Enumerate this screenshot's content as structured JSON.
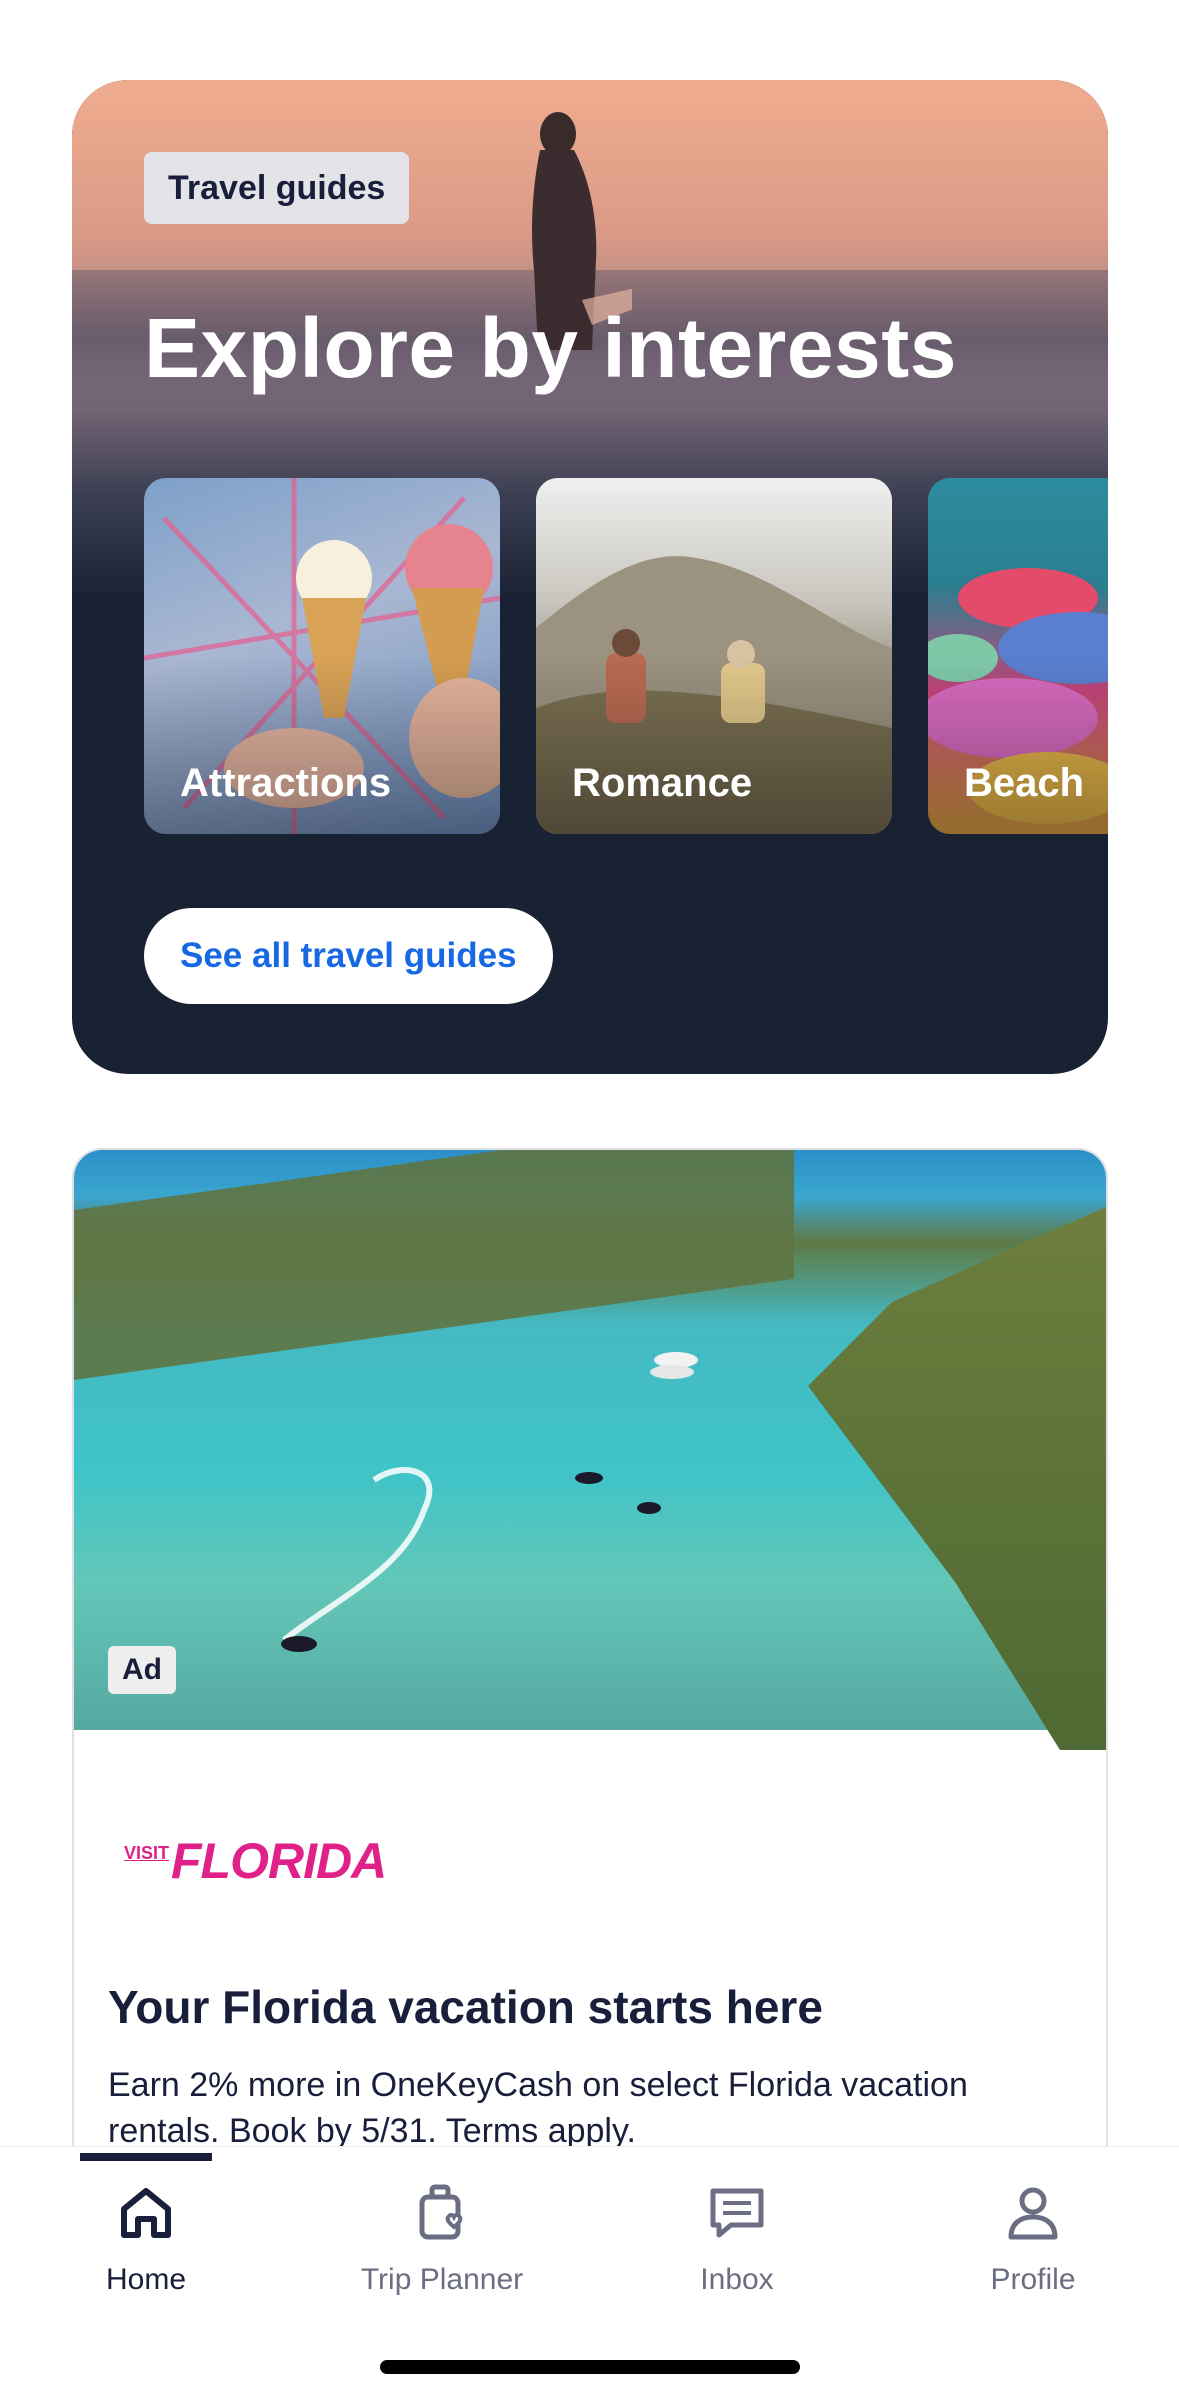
{
  "explore": {
    "tag": "Travel guides",
    "title": "Explore by interests",
    "tiles": [
      {
        "label": "Attractions"
      },
      {
        "label": "Romance"
      },
      {
        "label": "Beach"
      }
    ],
    "see_all": "See all travel guides"
  },
  "ad": {
    "badge": "Ad",
    "brand_small": "VISIT",
    "brand_main": "FLORIDA",
    "headline": "Your Florida vacation starts here",
    "body": "Earn 2% more in OneKeyCash on select Florida vacation rentals. Book by 5/31. Terms apply."
  },
  "nav": {
    "items": [
      {
        "label": "Home",
        "icon": "home-icon",
        "active": true
      },
      {
        "label": "Trip Planner",
        "icon": "trip-planner-icon",
        "active": false
      },
      {
        "label": "Inbox",
        "icon": "inbox-icon",
        "active": false
      },
      {
        "label": "Profile",
        "icon": "profile-icon",
        "active": false
      }
    ]
  },
  "colors": {
    "navy": "#191e3b",
    "link_blue": "#1668e3",
    "card_dark": "#192233",
    "brand_pink": "#e0218a"
  }
}
